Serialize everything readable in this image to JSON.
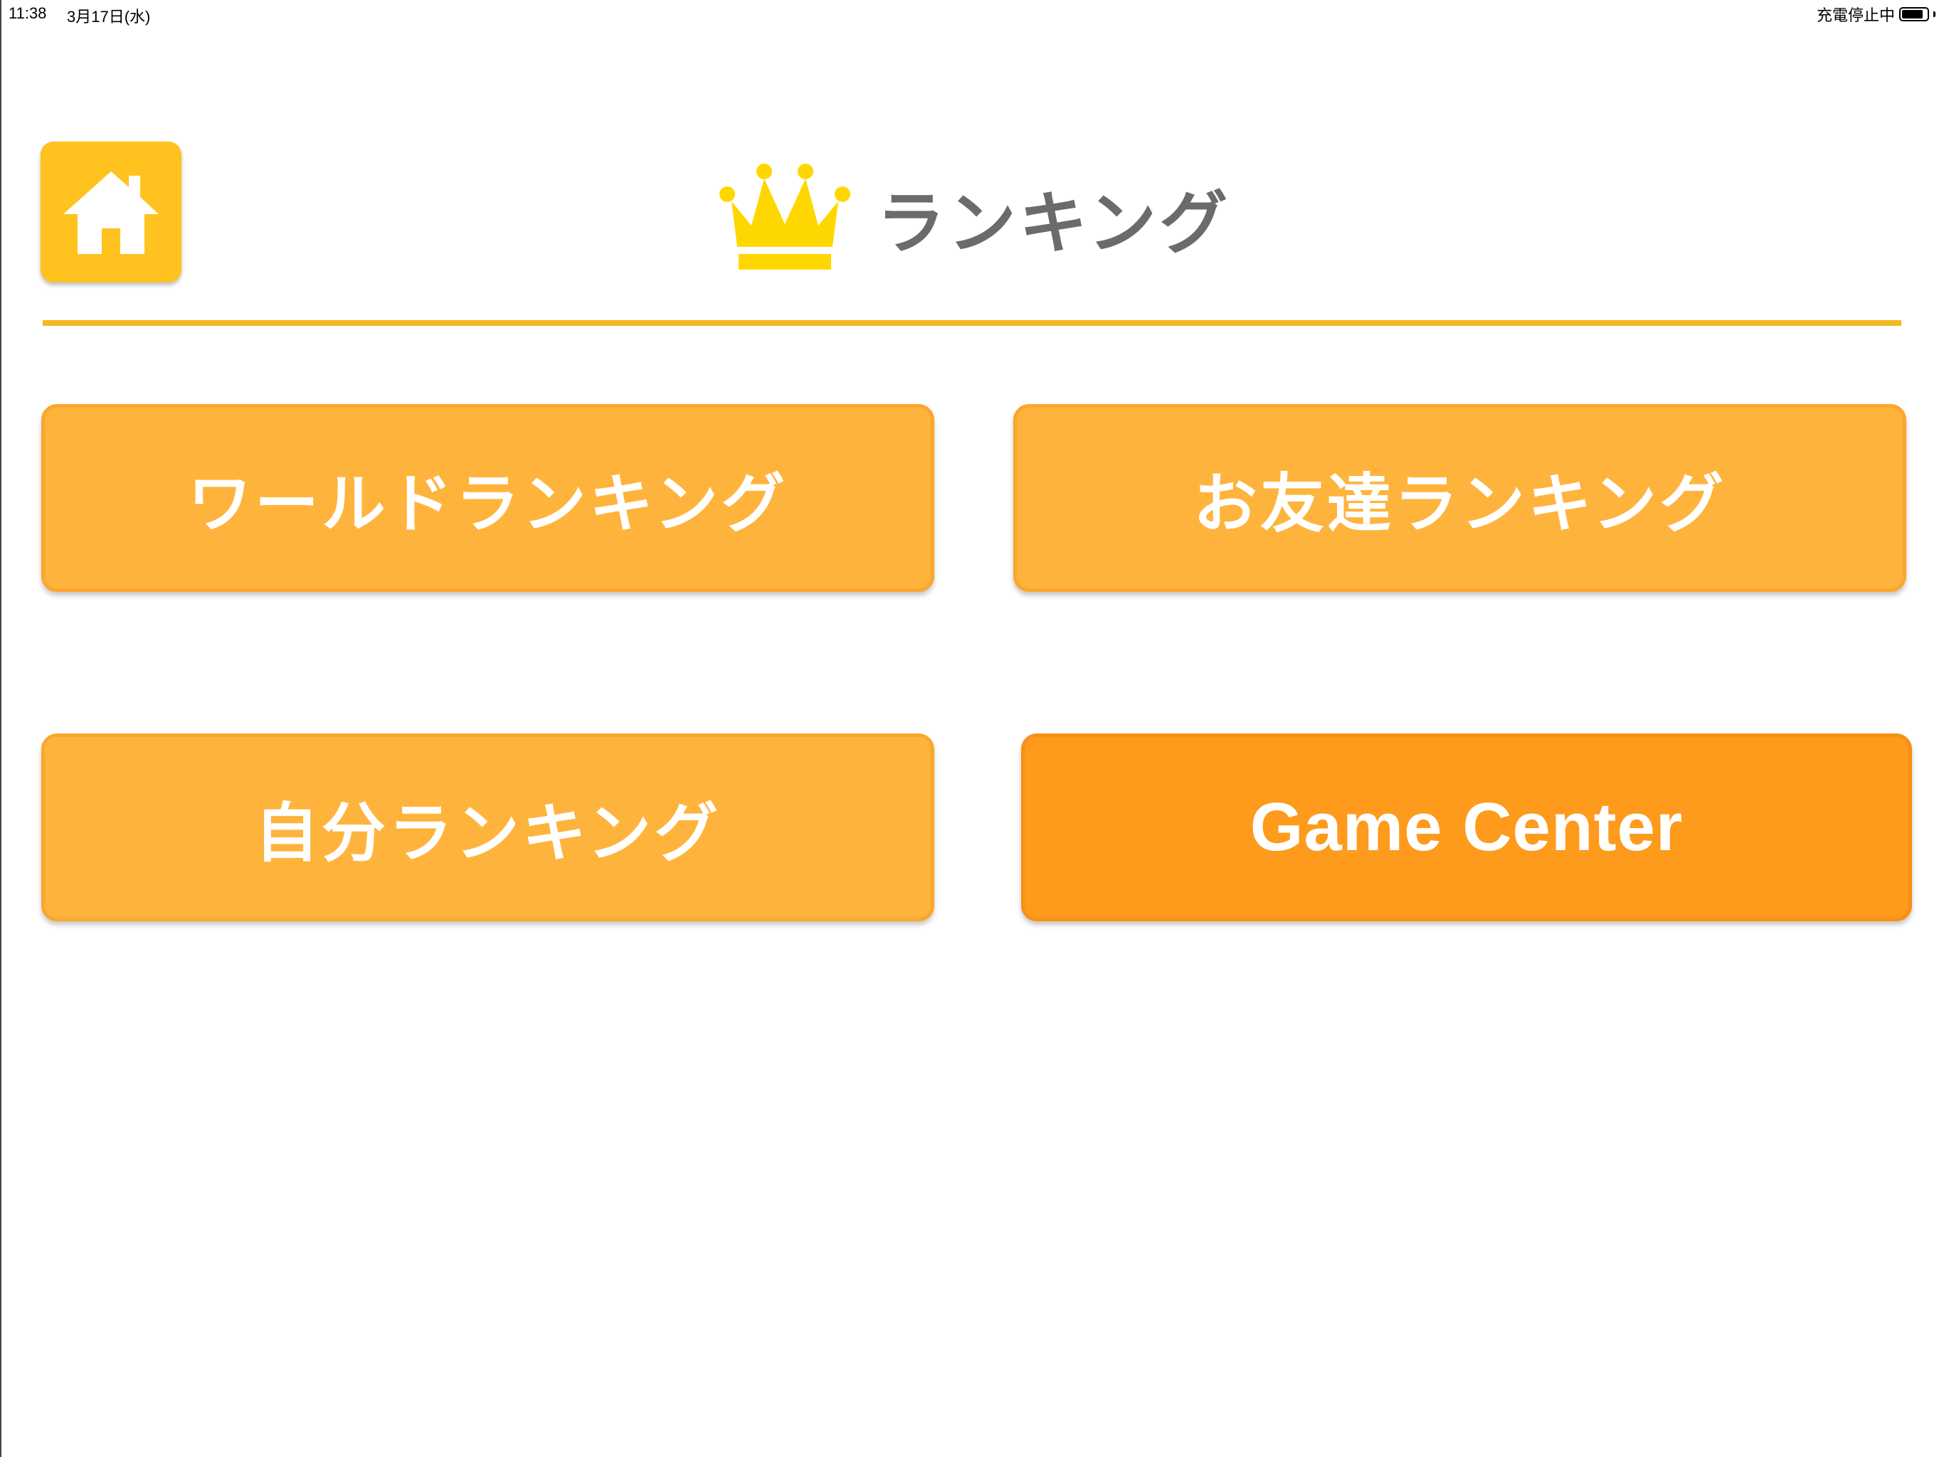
{
  "status_bar": {
    "time": "11:38",
    "date": "3月17日(水)",
    "charging": "充電停止中",
    "battery_level": 0.85
  },
  "header": {
    "home_icon": "home-icon",
    "crown_icon": "crown-icon",
    "title": "ランキング"
  },
  "buttons": {
    "world": "ワールドランキング",
    "friends": "お友達ランキング",
    "self": "自分ランキング",
    "game_center": "Game Center"
  },
  "colors": {
    "home_bg": "#ffc21f",
    "divider": "#f4b823",
    "button_light": "#feb43c",
    "button_dark": "#fe9a1c",
    "title_text": "#6b6b6b",
    "crown": "#ffd700"
  }
}
